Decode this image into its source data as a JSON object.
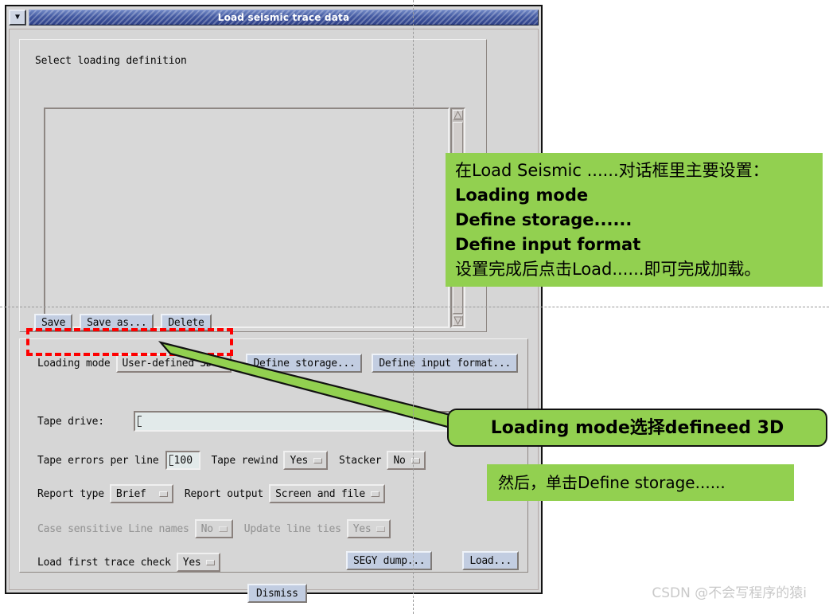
{
  "window": {
    "title": "Load seismic trace data",
    "menu_icon": "chevron-down-icon"
  },
  "selection": {
    "section_label": "Select loading definition",
    "list_items": [],
    "buttons": [
      {
        "label": "Save"
      },
      {
        "label": "Save as..."
      },
      {
        "label": "Delete"
      }
    ],
    "scrollbar": {
      "up_arrow": "scroll-up-icon",
      "down_arrow": "scroll-down-icon"
    }
  },
  "form": {
    "loading_mode": {
      "label": "Loading mode",
      "value": "User-defined 3D"
    },
    "define_storage_button": "Define storage...",
    "define_input_format_button": "Define input format...",
    "tape_drive": {
      "label": "Tape drive:",
      "value": "",
      "placeholder": ""
    },
    "tape_errors": {
      "label": "Tape errors per line",
      "value": "100"
    },
    "tape_rewind": {
      "label": "Tape rewind",
      "value": "Yes"
    },
    "stacker": {
      "label": "Stacker",
      "value": "No"
    },
    "report_type": {
      "label": "Report type",
      "value": "Brief"
    },
    "report_output": {
      "label": "Report output",
      "value": "Screen and file"
    },
    "case_sensitive": {
      "label": "Case sensitive Line names",
      "value": "No",
      "disabled": true
    },
    "update_line_ties": {
      "label": "Update line ties",
      "value": "Yes",
      "disabled": true
    },
    "load_first_trace_check": {
      "label": "Load first trace check",
      "value": "Yes"
    },
    "segy_dump_button": "SEGY dump...",
    "load_button": "Load..."
  },
  "footer": {
    "dismiss_button": "Dismiss"
  },
  "annotations": {
    "accent_green": "#92d050",
    "accent_red": "#fe0000",
    "main_note": {
      "line1": "在Load Seismic ......对话框里主要设置：",
      "line2": "Loading mode",
      "line3": "Define storage......",
      "line4": "Define input format",
      "line5": "设置完成后点击Load......即可完成加载。"
    },
    "bubble_note": "Loading mode选择defineed 3D",
    "second_note": "然后，单击Define storage......"
  },
  "watermark": "CSDN @不会写程序的猿i"
}
